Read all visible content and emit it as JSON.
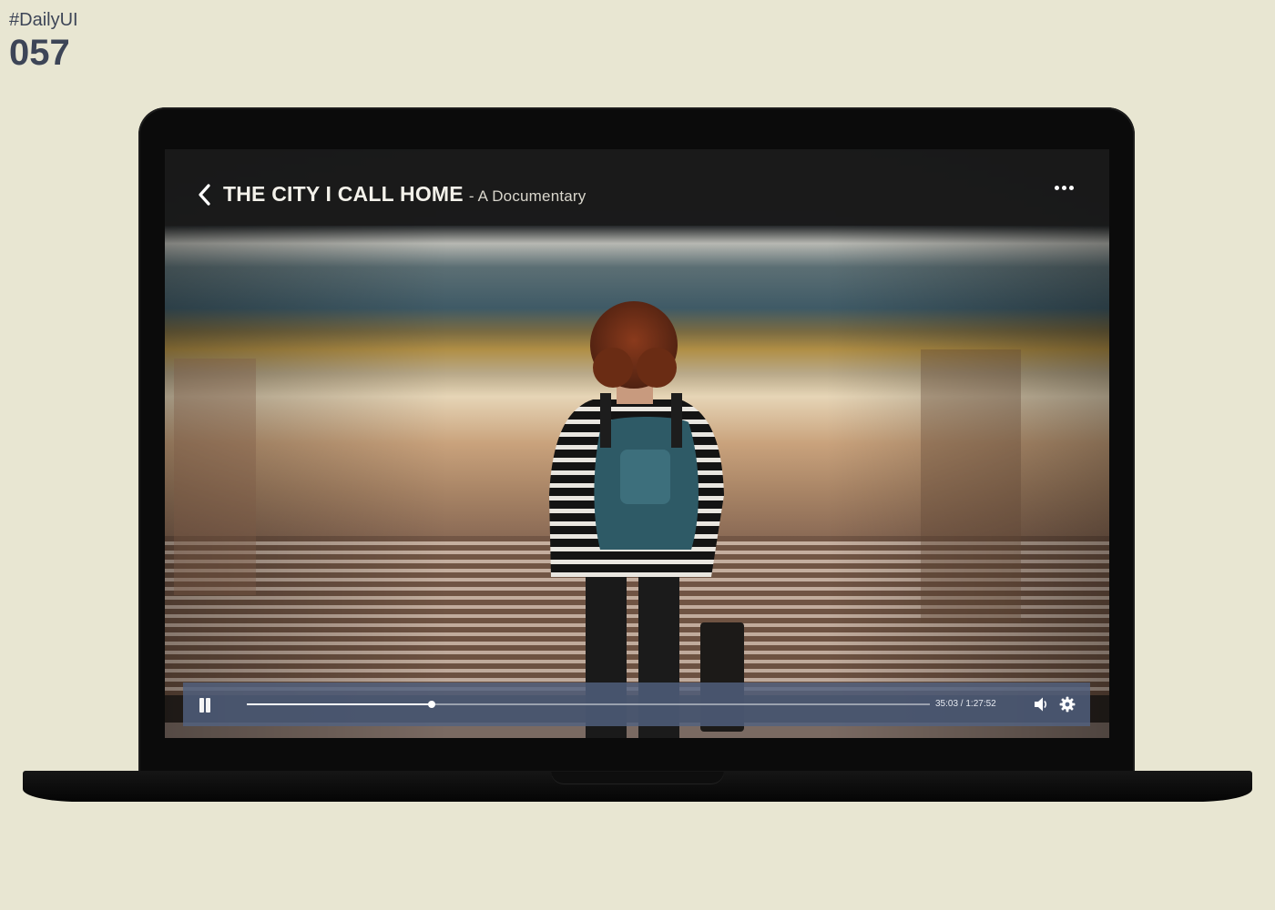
{
  "brand": {
    "tag": "#DailyUI",
    "number": "057"
  },
  "player": {
    "title": "THE CITY I CALL HOME",
    "subtitle": "- A Documentary",
    "time_display": "35:03 / 1:27:52",
    "progress_fraction": 0.27,
    "state": "playing"
  },
  "icons": {
    "back": "chevron-left-icon",
    "more": "more-horizontal-icon",
    "pause": "pause-icon",
    "volume": "volume-icon",
    "settings": "gear-icon"
  },
  "colors": {
    "page_background": "#e8e6d2",
    "brand_text": "#3d4557",
    "control_bar": "#526280"
  }
}
